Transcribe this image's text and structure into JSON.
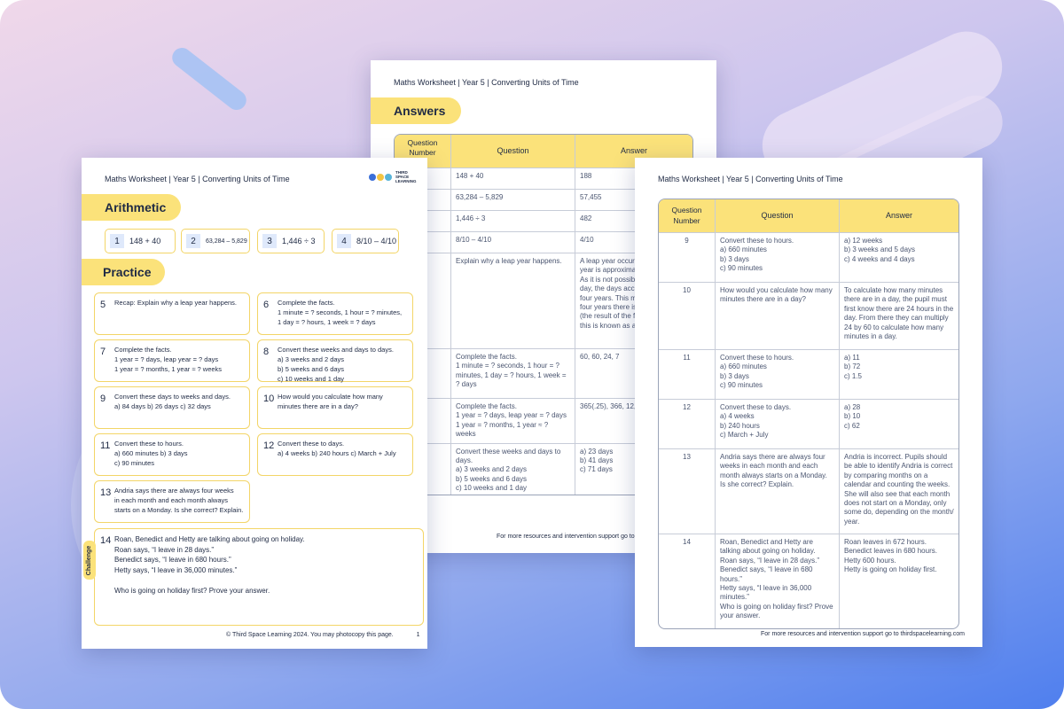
{
  "header_text": "Maths Worksheet | Year 5 | Converting Units of Time",
  "footer_resources": "For more resources and intervention support go to thirdspacelearning.com",
  "answers_page": {
    "pill": "Answers",
    "columns": [
      "Question Number",
      "Question",
      "Answer"
    ],
    "rows": [
      {
        "q": "148 + 40",
        "a": "188"
      },
      {
        "q": "63,284 – 5,829",
        "a": "57,455"
      },
      {
        "q": "1,446 ÷ 3",
        "a": "482"
      },
      {
        "q": "8/10 – 4/10",
        "a": "4/10"
      },
      {
        "q": "Explain why a leap year happens.",
        "a": "A leap year occurs because a year is approximately 365¼ days. As it is not possible to have ¼ of a day, the days accumulate over four years. This means that every four years there is an extra day (the result of the four ¼ days) and this is known as a leap year."
      },
      {
        "q": "Complete the facts.\n1 minute = ? seconds, 1 hour = ? minutes, 1 day = ? hours, 1 week = ? days",
        "a": "60, 60, 24, 7"
      },
      {
        "q": "Complete the facts.\n1 year = ? days, leap year = ? days\n1 year = ? months, 1 year ≈ ? weeks",
        "a": "365(.25), 366, 12, 52"
      },
      {
        "q": "Convert these weeks and days to days.\na) 3 weeks and 2 days\nb) 5 weeks and 6 days\nc) 10 weeks and 1 day",
        "a": "a) 23 days\nb) 41 days\nc) 71 days"
      }
    ]
  },
  "worksheet_page": {
    "logo_text": "THIRD SPACE LEARNING",
    "arithmetic_pill": "Arithmetic",
    "practice_pill": "Practice",
    "challenge_label": "Challenge",
    "arithmetic": [
      {
        "n": "1",
        "text": "148 + 40"
      },
      {
        "n": "2",
        "text": "63,284 – 5,829"
      },
      {
        "n": "3",
        "text": "1,446 ÷ 3"
      },
      {
        "n": "4",
        "text": "8/10 – 4/10"
      }
    ],
    "practice": [
      {
        "n": "5",
        "text": "Recap: Explain why a leap year happens."
      },
      {
        "n": "6",
        "text": "Complete the facts.\n1 minute = ? seconds, 1 hour = ? minutes,\n1 day = ? hours, 1 week = ? days"
      },
      {
        "n": "7",
        "text": "Complete the facts.\n1 year = ? days, leap year = ? days\n1 year = ? months, 1 year ≈ ? weeks"
      },
      {
        "n": "8",
        "text": "Convert these weeks and days to days.\na) 3 weeks and 2 days\nb) 5 weeks and 6 days\nc) 10 weeks and 1 day"
      },
      {
        "n": "9",
        "text": "Convert these days to weeks and days.\na) 84 days     b) 26 days     c) 32 days"
      },
      {
        "n": "10",
        "text": "How would you calculate how many\nminutes there are in a day?"
      },
      {
        "n": "11",
        "text": "Convert these to hours.\na) 660 minutes    b) 3 days\nc) 90 minutes"
      },
      {
        "n": "12",
        "text": "Convert these to days.\na) 4 weeks    b) 240 hours    c) March + July"
      },
      {
        "n": "13",
        "text": "Andria says there are always four weeks\nin each month and each month always\nstarts on a Monday. Is she correct? Explain."
      },
      {
        "n": "14",
        "text": "Roan, Benedict and Hetty are talking about going on holiday.\nRoan says, “I leave in 28 days.”\nBenedict says, “I leave in 680 hours.”\nHetty says, “I leave in 36,000 minutes.”\n\nWho is going on holiday first? Prove your answer."
      }
    ],
    "footer": "© Third Space Learning 2024. You may photocopy this page.",
    "page_number": "1"
  },
  "answers_page_2": {
    "columns": [
      "Question Number",
      "Question",
      "Answer"
    ],
    "rows": [
      {
        "n": "9",
        "q": "Convert these to hours.\na) 660 minutes\nb) 3 days\nc) 90 minutes",
        "a": "a) 12 weeks\nb) 3 weeks and 5 days\nc) 4 weeks and 4 days"
      },
      {
        "n": "10",
        "q": "How would you calculate how many minutes there are in a day?",
        "a": "To calculate how many minutes there are in a day, the pupil must first know there are 24 hours in the day. From there they can multiply 24 by 60 to calculate how many minutes in a day."
      },
      {
        "n": "11",
        "q": "Convert these to hours.\na) 660 minutes\nb) 3 days\nc) 90 minutes",
        "a": "a) 11\nb) 72\nc) 1.5"
      },
      {
        "n": "12",
        "q": "Convert these to days.\na) 4 weeks\nb) 240 hours\nc) March + July",
        "a": "a) 28\nb) 10\nc) 62"
      },
      {
        "n": "13",
        "q": "Andria says there are always four weeks in each month and each month always starts on a Monday. Is she correct? Explain.",
        "a": "Andria is incorrect. Pupils should be able to identify Andria is correct by comparing months on a calendar and counting the weeks. She will also see that each month does not start on a Monday, only some do, depending on the month/ year."
      },
      {
        "n": "14",
        "q": "Roan, Benedict and Hetty are talking about going on holiday.\nRoan says, “I leave in 28 days.”\nBenedict says, “I leave in 680 hours.”\nHetty says, “I leave in 36,000 minutes.”\nWho is going on holiday first? Prove your answer.",
        "a": "Roan leaves in 672 hours.\nBenedict leaves in 680 hours.\nHetty 600 hours.\nHetty is going on holiday first."
      }
    ]
  }
}
